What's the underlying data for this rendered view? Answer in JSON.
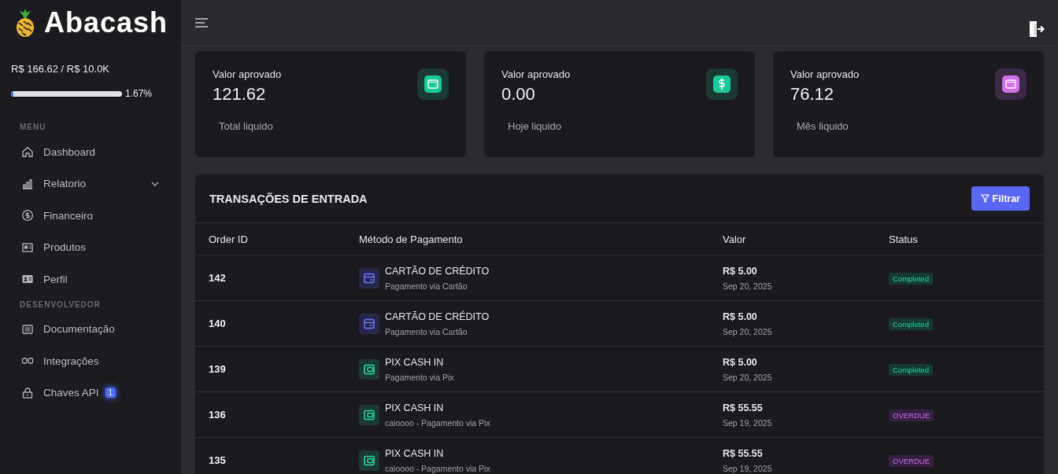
{
  "brand": {
    "name": "Abacash"
  },
  "limit": {
    "text": "R$ 166.62 / R$ 10.0K",
    "level": 0.0167,
    "percent": "1.67%"
  },
  "sidebar": {
    "sections": [
      {
        "title": "MENU",
        "items": [
          {
            "label": "Dashboard",
            "has_submenu": false
          },
          {
            "label": "Relatorio",
            "has_submenu": true
          },
          {
            "label": "Financeiro",
            "has_submenu": false
          },
          {
            "label": "Produtos",
            "has_submenu": false
          },
          {
            "label": "Perfil",
            "has_submenu": false
          }
        ]
      },
      {
        "title": "DESENVOLVEDOR",
        "items": [
          {
            "label": "Documentação",
            "has_submenu": false
          },
          {
            "label": "Integrações",
            "has_submenu": false
          },
          {
            "label": "Chaves API",
            "has_submenu": false,
            "badge": "1"
          }
        ]
      }
    ]
  },
  "stats": [
    {
      "label": "Valor aprovado",
      "value": "121.62",
      "footer": "Total liquido",
      "kind": "wallet",
      "color": "#19c99a"
    },
    {
      "label": "Valor aprovado",
      "value": "0.00",
      "footer": "Hoje liquido",
      "kind": "dollar",
      "color": "#19c99a"
    },
    {
      "label": "Valor aprovado",
      "value": "76.12",
      "footer": "Mês liquido",
      "kind": "wallet",
      "color": "#d070e8"
    }
  ],
  "table": {
    "title": "TRANSAÇÕES DE ENTRADA",
    "filter_button": "Filtrar",
    "columns": [
      "Order ID",
      "Método de Pagamento",
      "Valor",
      "Status"
    ],
    "rows": [
      {
        "order_id": "142",
        "method": {
          "kind": "card",
          "name": "CARTÃO DE CRÉDITO",
          "description": "Pagamento via Cartão"
        },
        "value": "R$ 5.00",
        "date": "Sep 20, 2025",
        "status": {
          "kind": "completed",
          "label": "Completed"
        }
      },
      {
        "order_id": "140",
        "method": {
          "kind": "card",
          "name": "CARTÃO DE CRÉDITO",
          "description": "Pagamento via Cartão"
        },
        "value": "R$ 5.00",
        "date": "Sep 20, 2025",
        "status": {
          "kind": "completed",
          "label": "Completed"
        }
      },
      {
        "order_id": "139",
        "method": {
          "kind": "pix",
          "name": "PIX CASH IN",
          "description": "Pagamento via Pix"
        },
        "value": "R$ 5.00",
        "date": "Sep 20, 2025",
        "status": {
          "kind": "completed",
          "label": "Completed"
        }
      },
      {
        "order_id": "136",
        "method": {
          "kind": "pix",
          "name": "PIX CASH IN",
          "description": "caioooo - Pagamento via Pix"
        },
        "value": "R$ 55.55",
        "date": "Sep 19, 2025",
        "status": {
          "kind": "overdue",
          "label": "OVERDUE"
        }
      },
      {
        "order_id": "135",
        "method": {
          "kind": "pix",
          "name": "PIX CASH IN",
          "description": "caioooo - Pagamento via Pix"
        },
        "value": "R$ 55.55",
        "date": "Sep 19, 2025",
        "status": {
          "kind": "overdue",
          "label": "OVERDUE"
        }
      }
    ]
  }
}
